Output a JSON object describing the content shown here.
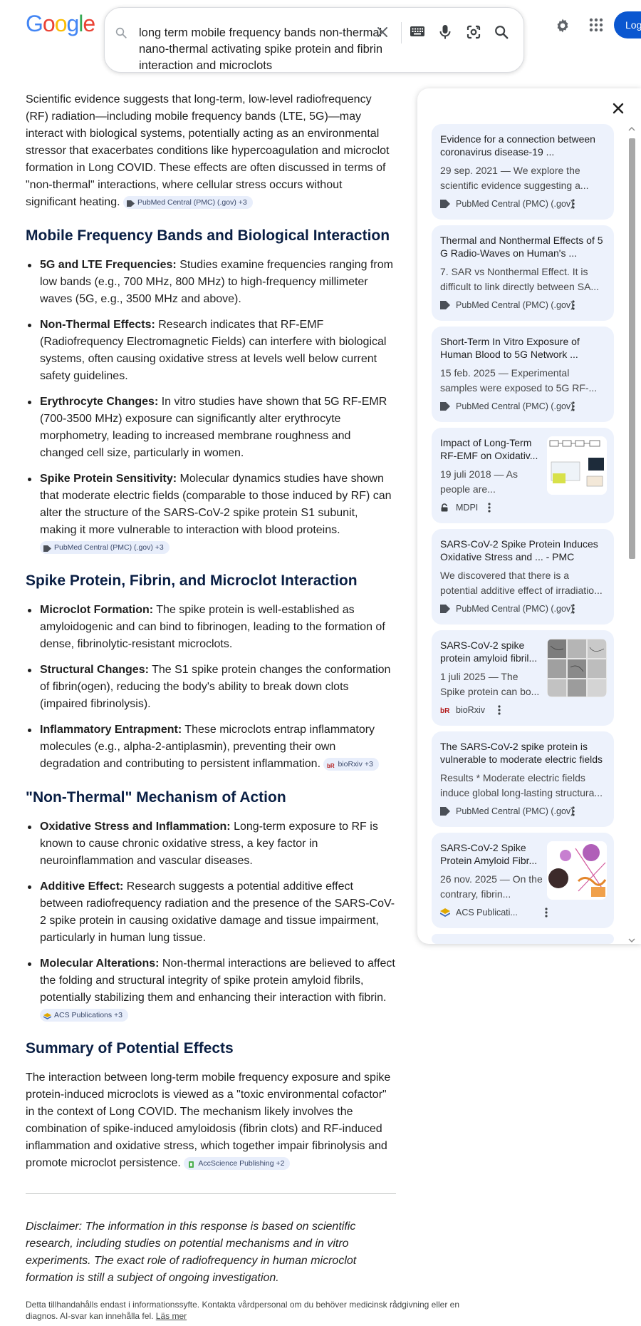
{
  "header": {
    "logo_letters": [
      "G",
      "o",
      "o",
      "g",
      "l",
      "e"
    ],
    "query": "long term mobile frequency bands non-thermal nano-thermal activating spike protein and fibrin interaction and microclots",
    "login_label": "Log in",
    "icons": [
      "search-icon",
      "close-icon",
      "keyboard-icon",
      "mic-icon",
      "lens-icon",
      "search-submit-icon",
      "gear-icon",
      "apps-icon"
    ],
    "accent_color": "#0b57d0"
  },
  "answer": {
    "intro": "Scientific evidence suggests that long-term, low-level radiofrequency (RF) radiation—including mobile frequency bands (LTE, 5G)—may interact with biological systems, potentially acting as an environmental stressor that exacerbates conditions like hypercoagulation and microclot formation in Long COVID. These effects are often discussed in terms of \"non-thermal\" interactions, where cellular stress occurs without significant heating.",
    "intro_chip": "PubMed Central (PMC) (.gov) +3",
    "sections": [
      {
        "heading": "Mobile Frequency Bands and Biological Interaction",
        "items": [
          {
            "term": "5G and LTE Frequencies:",
            "text": " Studies examine frequencies ranging from low bands (e.g., 700 MHz, 800 MHz) to high-frequency millimeter waves (5G, e.g., 3500 MHz and above)."
          },
          {
            "term": "Non-Thermal Effects:",
            "text": " Research indicates that RF-EMF (Radiofrequency Electromagnetic Fields) can interfere with biological systems, often causing oxidative stress at levels well below current safety guidelines."
          },
          {
            "term": "Erythrocyte Changes:",
            "text": " In vitro studies have shown that 5G RF-EMR (700-3500 MHz) exposure can significantly alter erythrocyte morphometry, leading to increased membrane roughness and changed cell size, particularly in women."
          },
          {
            "term": "Spike Protein Sensitivity:",
            "text": " Molecular dynamics studies have shown that moderate electric fields (comparable to those induced by RF) can alter the structure of the SARS-CoV-2 spike protein S1 subunit, making it more vulnerable to interaction with blood proteins.",
            "chip": "PubMed Central (PMC) (.gov) +3"
          }
        ]
      },
      {
        "heading": "Spike Protein, Fibrin, and Microclot Interaction",
        "items": [
          {
            "term": "Microclot Formation:",
            "text": " The spike protein is well-established as amyloidogenic and can bind to fibrinogen, leading to the formation of dense, fibrinolytic-resistant microclots."
          },
          {
            "term": "Structural Changes:",
            "text": " The S1 spike protein changes the conformation of fibrin(ogen), reducing the body's ability to break down clots (impaired fibrinolysis)."
          },
          {
            "term": "Inflammatory Entrapment:",
            "text": " These microclots entrap inflammatory molecules (e.g., alpha-2-antiplasmin), preventing their own degradation and contributing to persistent inflammation.",
            "chip": "bioRxiv +3"
          }
        ]
      },
      {
        "heading": "\"Non-Thermal\" Mechanism of Action",
        "items": [
          {
            "term": "Oxidative Stress and Inflammation:",
            "text": " Long-term exposure to RF is known to cause chronic oxidative stress, a key factor in neuroinflammation and vascular diseases."
          },
          {
            "term": "Additive Effect:",
            "text": " Research suggests a potential additive effect between radiofrequency radiation and the presence of the SARS-CoV-2 spike protein in causing oxidative damage and tissue impairment, particularly in human lung tissue."
          },
          {
            "term": "Molecular Alterations:",
            "text": " Non-thermal interactions are believed to affect the folding and structural integrity of spike protein amyloid fibrils, potentially stabilizing them and enhancing their interaction with fibrin.",
            "chip": "ACS Publications +3"
          }
        ]
      }
    ],
    "summary_heading": "Summary of Potential Effects",
    "summary": "The interaction between long-term mobile frequency exposure and spike protein-induced microclots is viewed as a \"toxic environmental cofactor\" in the context of Long COVID. The mechanism likely involves the combination of spike-induced amyloidosis (fibrin clots) and RF-induced inflammation and oxidative stress, which together impair fibrinolysis and promote microclot persistence.",
    "summary_chip": "AccScience Publishing +2",
    "disclaimer": "Disclaimer: The information in this response is based on scientific research, including studies on potential mechanisms and in vitro experiments. The exact role of radiofrequency in human microclot formation is still a subject of ongoing investigation.",
    "footnote": "Detta tillhandahålls endast i informationssyfte. Kontakta vårdpersonal om du behöver medicinsk rådgivning eller en diagnos. AI-svar kan innehålla fel.",
    "footnote_link": "Läs mer"
  },
  "sources": [
    {
      "title": "Evidence for a connection between coronavirus disease-19 ...",
      "snippet": "29 sep. 2021 — We explore the scientific evidence suggesting a...",
      "source": "PubMed Central (PMC) (.gov)",
      "icon": "pmc-icon"
    },
    {
      "title": "Thermal and Nonthermal Effects of 5 G Radio-Waves on Human's ...",
      "snippet": "7. SAR vs Nonthermal Effect. It is difficult to link directly between SA...",
      "source": "PubMed Central (PMC) (.gov)",
      "icon": "pmc-icon"
    },
    {
      "title": "Short-Term In Vitro Exposure of Human Blood to 5G Network ...",
      "snippet": "15 feb. 2025 — Experimental samples were exposed to 5G RF-...",
      "source": "PubMed Central (PMC) (.gov)",
      "icon": "pmc-icon"
    },
    {
      "title": "Impact of Long-Term RF-EMF on Oxidativ...",
      "snippet": "19 juli 2018 — As people are...",
      "source": "MDPI",
      "icon": "mdpi-icon",
      "thumb": "diagram"
    },
    {
      "title": "SARS-CoV-2 Spike Protein Induces Oxidative Stress and ... - PMC",
      "snippet": "We discovered that there is a potential additive effect of irradiatio...",
      "source": "PubMed Central (PMC) (.gov)",
      "icon": "pmc-icon"
    },
    {
      "title": "SARS-CoV-2 spike protein amyloid fibril...",
      "snippet": "1 juli 2025 — The Spike protein can bo...",
      "source": "bioRxiv",
      "icon": "biorxiv-icon",
      "thumb": "micrograph"
    },
    {
      "title": "The SARS-CoV-2 spike protein is vulnerable to moderate electric fields",
      "snippet": "Results * Moderate electric fields induce global long-lasting structura...",
      "source": "PubMed Central (PMC) (.gov)",
      "icon": "pmc-icon"
    },
    {
      "title": "SARS-CoV-2 Spike Protein Amyloid Fibr...",
      "snippet": "26 nov. 2025 — On the contrary, fibrin...",
      "source": "ACS Publicati...",
      "icon": "acs-icon",
      "thumb": "molecular"
    }
  ]
}
